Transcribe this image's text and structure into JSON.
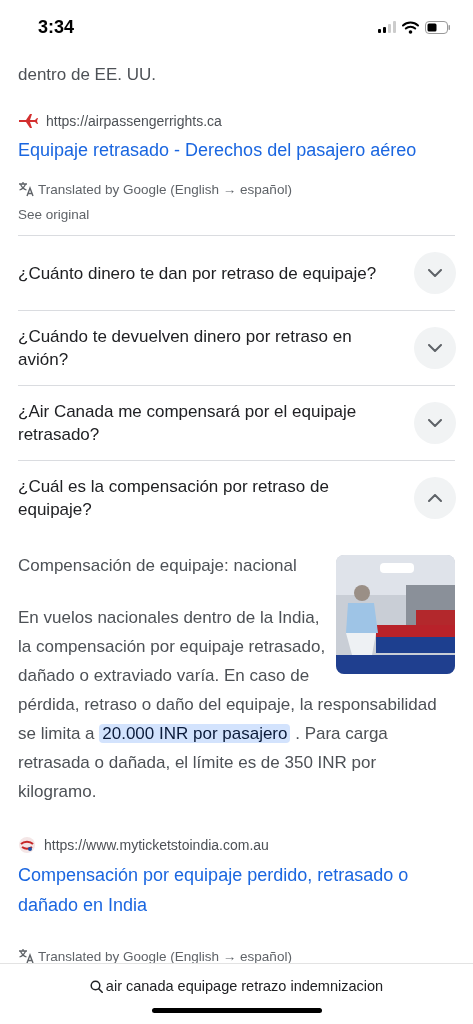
{
  "status_bar": {
    "time": "3:34"
  },
  "snippet_end": "dentro de EE. UU.",
  "results": [
    {
      "kind": "plane",
      "url": "https://airpassengerrights.ca",
      "title": "Equipaje retrasado - Derechos del pasajero aéreo",
      "translated": "Translated by Google (English → español)",
      "see_original": "See original"
    }
  ],
  "questions": [
    {
      "text": "¿Cuánto dinero te dan por retraso de equipaje?",
      "expanded": false
    },
    {
      "text": "¿Cuándo te devuelven dinero por retraso en avión?",
      "expanded": false
    },
    {
      "text": "¿Air Canada me compensará por el equipaje retrasado?",
      "expanded": false
    },
    {
      "text": "¿Cuál es la compensación por retraso de equipaje?",
      "expanded": true,
      "answer": {
        "heading": "Compensación de equipaje: nacional",
        "before": "En vuelos nacionales dentro de la India, la compensación por equipaje retrasado, dañado o extraviado varía. En caso de pérdida, retraso o daño del equipaje, la responsabilidad se limita a ",
        "highlight": "20.000 INR por pasajero",
        "after": " . Para carga retrasada o dañada, el límite es de 350 INR por kilogramo."
      },
      "source": {
        "kind": "logo",
        "url": "https://www.myticketstoindia.com.au",
        "title": "Compensación por equipaje perdido, retrasado o dañado en India",
        "translated": "Translated by Google (English → español)"
      }
    }
  ],
  "search_bar": {
    "query": "air canada equipage retrazo indemnizacion"
  }
}
